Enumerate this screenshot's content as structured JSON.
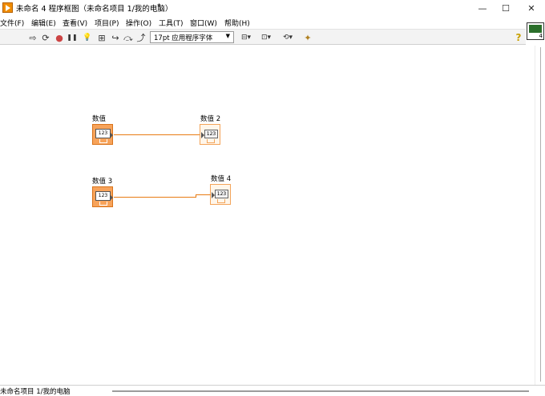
{
  "window": {
    "title": "未命名 4 程序框图（未命名项目 1/我的电脑）",
    "modified_marker": "*",
    "minimize_symbol": "—",
    "maximize_symbol": "☐",
    "close_symbol": "✕"
  },
  "menu": {
    "items": [
      "文件(F)",
      "编辑(E)",
      "查看(V)",
      "项目(P)",
      "操作(O)",
      "工具(T)",
      "窗口(W)",
      "帮助(H)"
    ]
  },
  "toolbar": {
    "buttons": [
      {
        "name": "run-arrow-icon",
        "glyph": "⇨"
      },
      {
        "name": "run-continuously-icon",
        "glyph": "⟳"
      },
      {
        "name": "abort-icon",
        "glyph": "●"
      },
      {
        "name": "pause-icon",
        "glyph": "❚❚"
      },
      {
        "name": "highlight-execution-icon",
        "glyph": "💡"
      },
      {
        "name": "retain-wire-values-icon",
        "glyph": "⊞"
      },
      {
        "name": "step-into-icon",
        "glyph": "↪"
      },
      {
        "name": "step-over-icon",
        "glyph": "⤼"
      },
      {
        "name": "step-out-icon",
        "glyph": "⤴"
      }
    ],
    "font_dropdown": "17pt 应用程序字体",
    "font_dropdown_arrow": "▼",
    "right_buttons": [
      {
        "name": "align-objects-icon",
        "glyph": "⊟▾"
      },
      {
        "name": "distribute-objects-icon",
        "glyph": "⊡▾"
      },
      {
        "name": "reorder-icon",
        "glyph": "⟲▾"
      },
      {
        "name": "clean-up-diagram-icon",
        "glyph": "✦"
      }
    ],
    "help_symbol": "?",
    "connector_number": "4"
  },
  "diagram": {
    "nodes": [
      {
        "label": "数值",
        "display": "123"
      },
      {
        "label": "数值 2",
        "display": "123"
      },
      {
        "label": "数值 3",
        "display": "123"
      },
      {
        "label": "数值 4",
        "display": "123"
      }
    ],
    "wire_color": "#e87b12"
  },
  "status": {
    "text": "未命名项目 1/我的电脑"
  }
}
